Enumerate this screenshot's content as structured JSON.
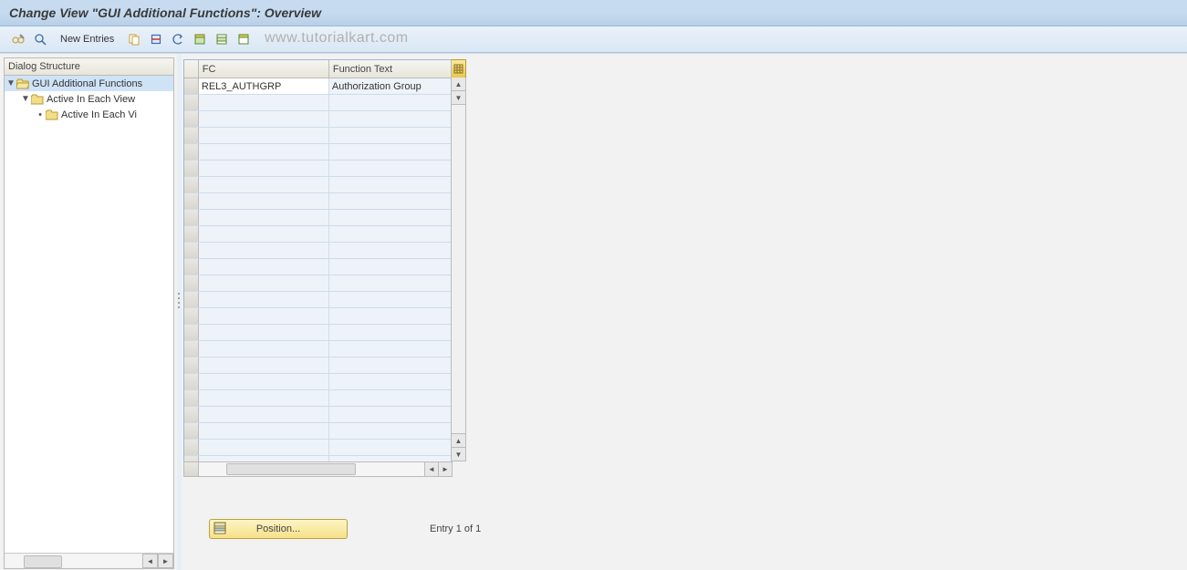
{
  "title": "Change View \"GUI Additional Functions\": Overview",
  "toolbar": {
    "new_entries_label": "New Entries"
  },
  "watermark": "www.tutorialkart.com",
  "tree": {
    "header": "Dialog Structure",
    "nodes": [
      {
        "indent": 0,
        "expanded": true,
        "open_folder": true,
        "label": "GUI Additional Functions",
        "selected": true
      },
      {
        "indent": 1,
        "expanded": true,
        "open_folder": false,
        "label": "Active In Each View",
        "selected": false
      },
      {
        "indent": 2,
        "expanded": null,
        "open_folder": false,
        "label": "Active In Each Vi",
        "selected": false
      }
    ]
  },
  "table": {
    "columns": {
      "fc": "FC",
      "ft": "Function Text"
    },
    "rows": [
      {
        "fc": "REL3_AUTHGRP",
        "ft": "Authorization Group"
      }
    ],
    "empty_rows": 23
  },
  "footer": {
    "position_label": "Position...",
    "entry_label": "Entry 1 of 1"
  }
}
